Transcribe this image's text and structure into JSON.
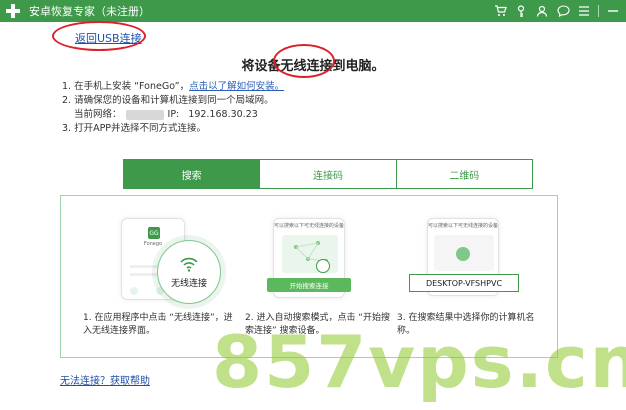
{
  "titlebar": {
    "title": "安卓恢复专家（未注册）",
    "icons": [
      "cart-icon",
      "key-icon",
      "user-icon",
      "chat-icon",
      "menu-icon",
      "minimize-icon"
    ]
  },
  "back_link": "返回USB连接",
  "main_title": "将设备无线连接到电脑。",
  "steps": {
    "s1_prefix": "1. 在手机上安装 “FoneGo”，",
    "s1_link": "点击以了解如何安装。",
    "s2": "2. 请确保您的设备和计算机连接到同一个局域网。",
    "s2_net_label": "当前网络：",
    "s2_ip_label": "IP:",
    "s2_ip_value": "192.168.30.23",
    "s3": "3. 打开APP并选择不同方式连接。"
  },
  "tabs": [
    {
      "label": "搜索",
      "active": true
    },
    {
      "label": "连接码",
      "active": false
    },
    {
      "label": "二维码",
      "active": false
    }
  ],
  "cards": {
    "card1": {
      "badge": "GG",
      "app_name": "Fonego",
      "circle_label": "无线连接",
      "caption": "1. 在应用程序中点击 “无线连接”，进入无线连接界面。"
    },
    "card2": {
      "header": "可以搜索以下可无线连接的设备",
      "button": "开始搜索连接",
      "caption": "2. 进入自动搜索模式，点击 “开始搜索连接” 搜索设备。"
    },
    "card3": {
      "header": "可以搜索以下可无线连接的设备",
      "device": "DESKTOP-VFSHPVC",
      "caption": "3. 在搜索结果中选择你的计算机名称。"
    }
  },
  "help_link": "无法连接？获取帮助",
  "watermark": "857vps.cn",
  "colors": {
    "brand": "#3e9a4a",
    "link": "#1f4fa8",
    "annotation": "#d9222a",
    "watermark": "#8cc828"
  }
}
